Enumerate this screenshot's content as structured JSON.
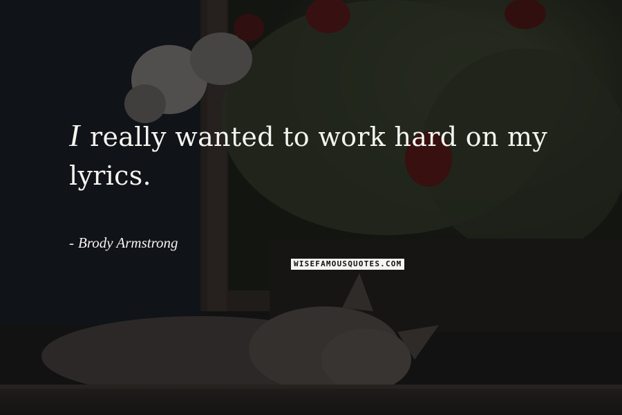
{
  "quote": {
    "first_letter": "I",
    "rest": "really wanted to work hard on my lyrics."
  },
  "author": {
    "dash": "-",
    "name": "Brody Armstrong"
  },
  "watermark": {
    "text": "WISEFAMOUSQUOTES.COM"
  },
  "colors": {
    "text": "#f4f4f0",
    "background_dark": "#141414"
  }
}
